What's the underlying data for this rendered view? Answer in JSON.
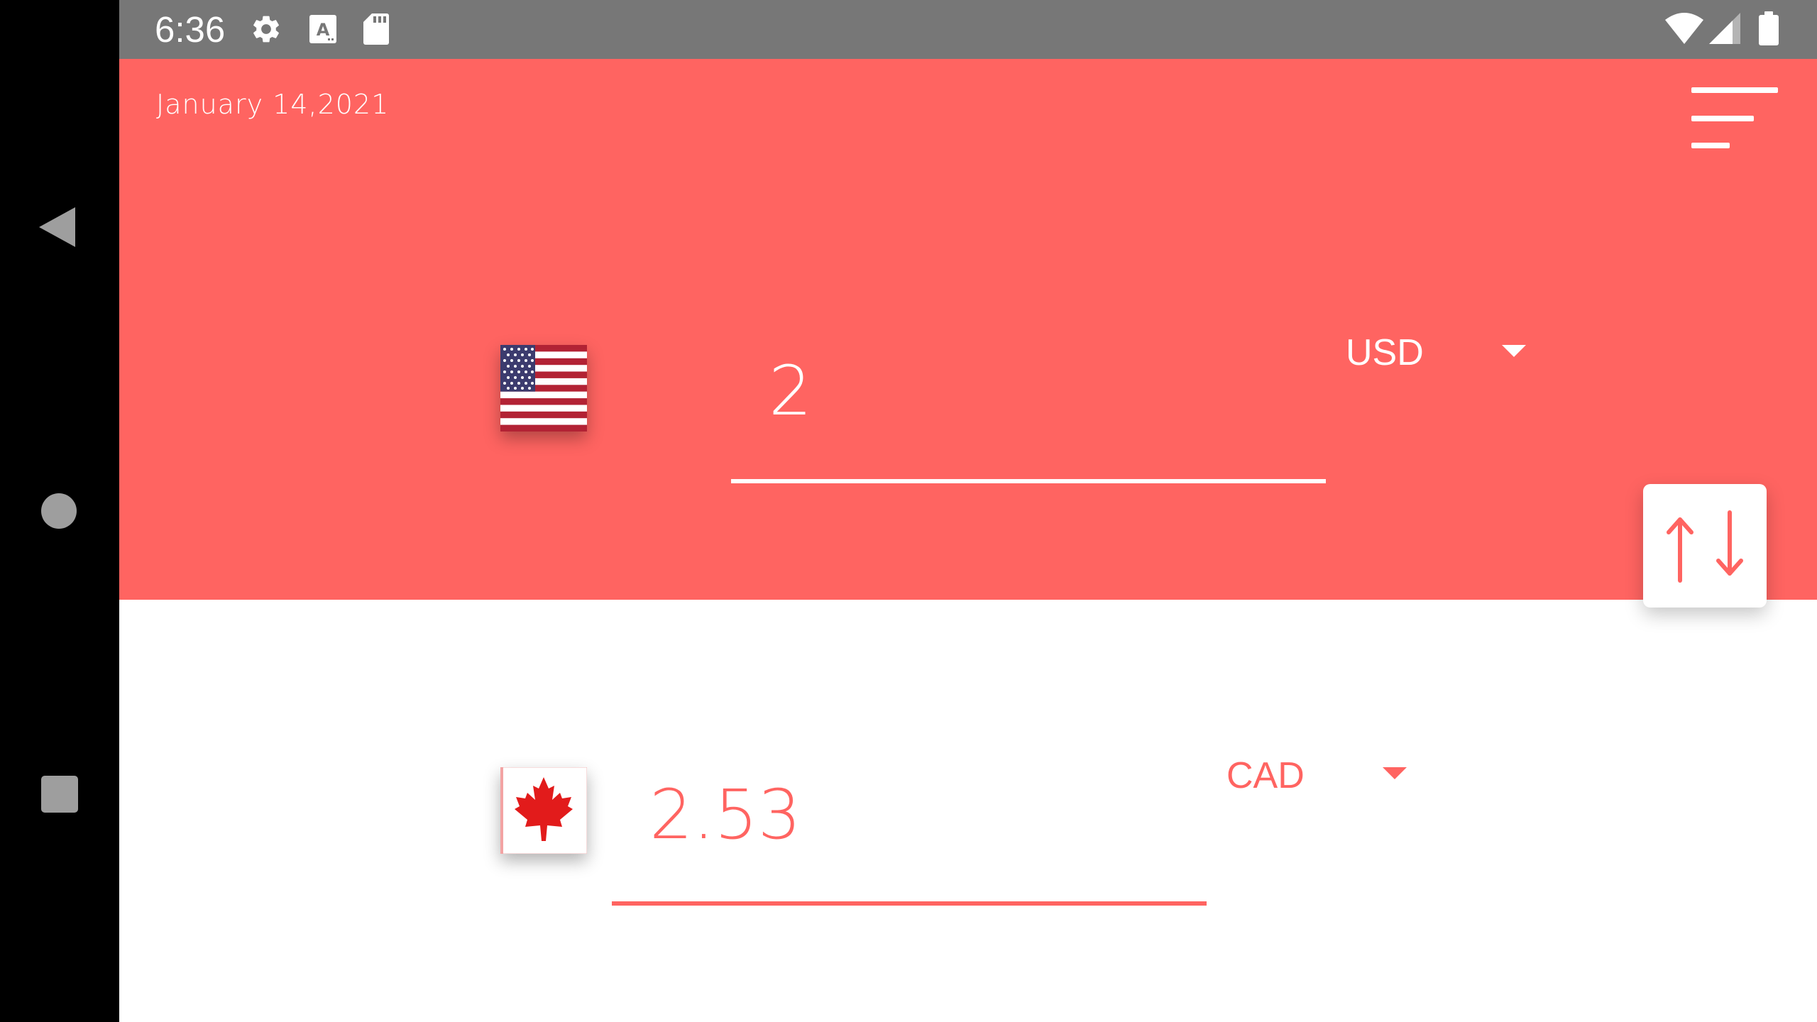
{
  "status_bar": {
    "time": "6:36",
    "icons": [
      "settings-gear-icon",
      "text-a-icon",
      "sd-card-icon",
      "wifi-icon",
      "cell-signal-icon",
      "battery-icon"
    ]
  },
  "navigation_bar": {
    "buttons": [
      "back-icon",
      "home-icon",
      "recents-icon"
    ]
  },
  "header": {
    "date": "January 14,2021",
    "menu_icon": "menu-lines-icon"
  },
  "from_currency": {
    "amount": "2",
    "code": "USD",
    "flag": "us-flag-icon"
  },
  "to_currency": {
    "amount": "2.53",
    "code": "CAD",
    "flag": "canada-flag-icon"
  },
  "swap_button": {
    "icon": "swap-arrows-icon"
  },
  "colors": {
    "accent": "#ff6461",
    "status_bar": "#777777",
    "background": "#ffffff",
    "nav_bar": "#000000",
    "nav_icons": "#9e9e9e"
  }
}
